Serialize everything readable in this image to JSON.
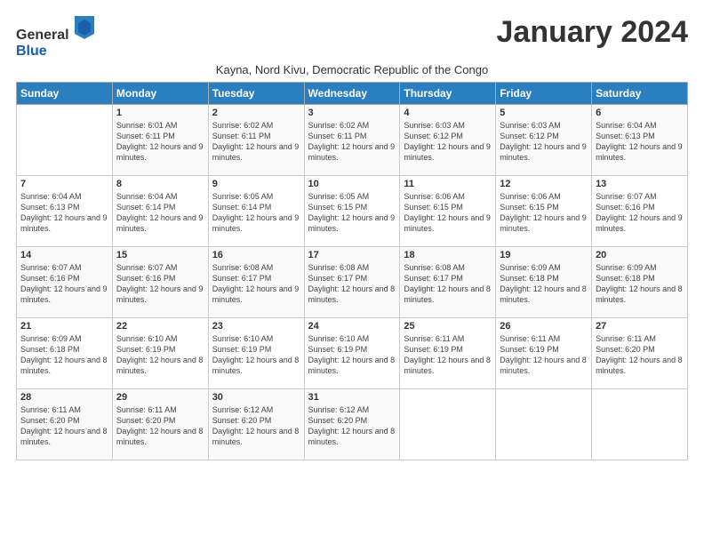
{
  "logo": {
    "text_general": "General",
    "text_blue": "Blue"
  },
  "header": {
    "month_title": "January 2024",
    "subtitle": "Kayna, Nord Kivu, Democratic Republic of the Congo"
  },
  "days_of_week": [
    "Sunday",
    "Monday",
    "Tuesday",
    "Wednesday",
    "Thursday",
    "Friday",
    "Saturday"
  ],
  "weeks": [
    [
      {
        "day": "",
        "sunrise": "",
        "sunset": "",
        "daylight": ""
      },
      {
        "day": "1",
        "sunrise": "Sunrise: 6:01 AM",
        "sunset": "Sunset: 6:11 PM",
        "daylight": "Daylight: 12 hours and 9 minutes."
      },
      {
        "day": "2",
        "sunrise": "Sunrise: 6:02 AM",
        "sunset": "Sunset: 6:11 PM",
        "daylight": "Daylight: 12 hours and 9 minutes."
      },
      {
        "day": "3",
        "sunrise": "Sunrise: 6:02 AM",
        "sunset": "Sunset: 6:11 PM",
        "daylight": "Daylight: 12 hours and 9 minutes."
      },
      {
        "day": "4",
        "sunrise": "Sunrise: 6:03 AM",
        "sunset": "Sunset: 6:12 PM",
        "daylight": "Daylight: 12 hours and 9 minutes."
      },
      {
        "day": "5",
        "sunrise": "Sunrise: 6:03 AM",
        "sunset": "Sunset: 6:12 PM",
        "daylight": "Daylight: 12 hours and 9 minutes."
      },
      {
        "day": "6",
        "sunrise": "Sunrise: 6:04 AM",
        "sunset": "Sunset: 6:13 PM",
        "daylight": "Daylight: 12 hours and 9 minutes."
      }
    ],
    [
      {
        "day": "7",
        "sunrise": "Sunrise: 6:04 AM",
        "sunset": "Sunset: 6:13 PM",
        "daylight": "Daylight: 12 hours and 9 minutes."
      },
      {
        "day": "8",
        "sunrise": "Sunrise: 6:04 AM",
        "sunset": "Sunset: 6:14 PM",
        "daylight": "Daylight: 12 hours and 9 minutes."
      },
      {
        "day": "9",
        "sunrise": "Sunrise: 6:05 AM",
        "sunset": "Sunset: 6:14 PM",
        "daylight": "Daylight: 12 hours and 9 minutes."
      },
      {
        "day": "10",
        "sunrise": "Sunrise: 6:05 AM",
        "sunset": "Sunset: 6:15 PM",
        "daylight": "Daylight: 12 hours and 9 minutes."
      },
      {
        "day": "11",
        "sunrise": "Sunrise: 6:06 AM",
        "sunset": "Sunset: 6:15 PM",
        "daylight": "Daylight: 12 hours and 9 minutes."
      },
      {
        "day": "12",
        "sunrise": "Sunrise: 6:06 AM",
        "sunset": "Sunset: 6:15 PM",
        "daylight": "Daylight: 12 hours and 9 minutes."
      },
      {
        "day": "13",
        "sunrise": "Sunrise: 6:07 AM",
        "sunset": "Sunset: 6:16 PM",
        "daylight": "Daylight: 12 hours and 9 minutes."
      }
    ],
    [
      {
        "day": "14",
        "sunrise": "Sunrise: 6:07 AM",
        "sunset": "Sunset: 6:16 PM",
        "daylight": "Daylight: 12 hours and 9 minutes."
      },
      {
        "day": "15",
        "sunrise": "Sunrise: 6:07 AM",
        "sunset": "Sunset: 6:16 PM",
        "daylight": "Daylight: 12 hours and 9 minutes."
      },
      {
        "day": "16",
        "sunrise": "Sunrise: 6:08 AM",
        "sunset": "Sunset: 6:17 PM",
        "daylight": "Daylight: 12 hours and 9 minutes."
      },
      {
        "day": "17",
        "sunrise": "Sunrise: 6:08 AM",
        "sunset": "Sunset: 6:17 PM",
        "daylight": "Daylight: 12 hours and 8 minutes."
      },
      {
        "day": "18",
        "sunrise": "Sunrise: 6:08 AM",
        "sunset": "Sunset: 6:17 PM",
        "daylight": "Daylight: 12 hours and 8 minutes."
      },
      {
        "day": "19",
        "sunrise": "Sunrise: 6:09 AM",
        "sunset": "Sunset: 6:18 PM",
        "daylight": "Daylight: 12 hours and 8 minutes."
      },
      {
        "day": "20",
        "sunrise": "Sunrise: 6:09 AM",
        "sunset": "Sunset: 6:18 PM",
        "daylight": "Daylight: 12 hours and 8 minutes."
      }
    ],
    [
      {
        "day": "21",
        "sunrise": "Sunrise: 6:09 AM",
        "sunset": "Sunset: 6:18 PM",
        "daylight": "Daylight: 12 hours and 8 minutes."
      },
      {
        "day": "22",
        "sunrise": "Sunrise: 6:10 AM",
        "sunset": "Sunset: 6:19 PM",
        "daylight": "Daylight: 12 hours and 8 minutes."
      },
      {
        "day": "23",
        "sunrise": "Sunrise: 6:10 AM",
        "sunset": "Sunset: 6:19 PM",
        "daylight": "Daylight: 12 hours and 8 minutes."
      },
      {
        "day": "24",
        "sunrise": "Sunrise: 6:10 AM",
        "sunset": "Sunset: 6:19 PM",
        "daylight": "Daylight: 12 hours and 8 minutes."
      },
      {
        "day": "25",
        "sunrise": "Sunrise: 6:11 AM",
        "sunset": "Sunset: 6:19 PM",
        "daylight": "Daylight: 12 hours and 8 minutes."
      },
      {
        "day": "26",
        "sunrise": "Sunrise: 6:11 AM",
        "sunset": "Sunset: 6:19 PM",
        "daylight": "Daylight: 12 hours and 8 minutes."
      },
      {
        "day": "27",
        "sunrise": "Sunrise: 6:11 AM",
        "sunset": "Sunset: 6:20 PM",
        "daylight": "Daylight: 12 hours and 8 minutes."
      }
    ],
    [
      {
        "day": "28",
        "sunrise": "Sunrise: 6:11 AM",
        "sunset": "Sunset: 6:20 PM",
        "daylight": "Daylight: 12 hours and 8 minutes."
      },
      {
        "day": "29",
        "sunrise": "Sunrise: 6:11 AM",
        "sunset": "Sunset: 6:20 PM",
        "daylight": "Daylight: 12 hours and 8 minutes."
      },
      {
        "day": "30",
        "sunrise": "Sunrise: 6:12 AM",
        "sunset": "Sunset: 6:20 PM",
        "daylight": "Daylight: 12 hours and 8 minutes."
      },
      {
        "day": "31",
        "sunrise": "Sunrise: 6:12 AM",
        "sunset": "Sunset: 6:20 PM",
        "daylight": "Daylight: 12 hours and 8 minutes."
      },
      {
        "day": "",
        "sunrise": "",
        "sunset": "",
        "daylight": ""
      },
      {
        "day": "",
        "sunrise": "",
        "sunset": "",
        "daylight": ""
      },
      {
        "day": "",
        "sunrise": "",
        "sunset": "",
        "daylight": ""
      }
    ]
  ]
}
